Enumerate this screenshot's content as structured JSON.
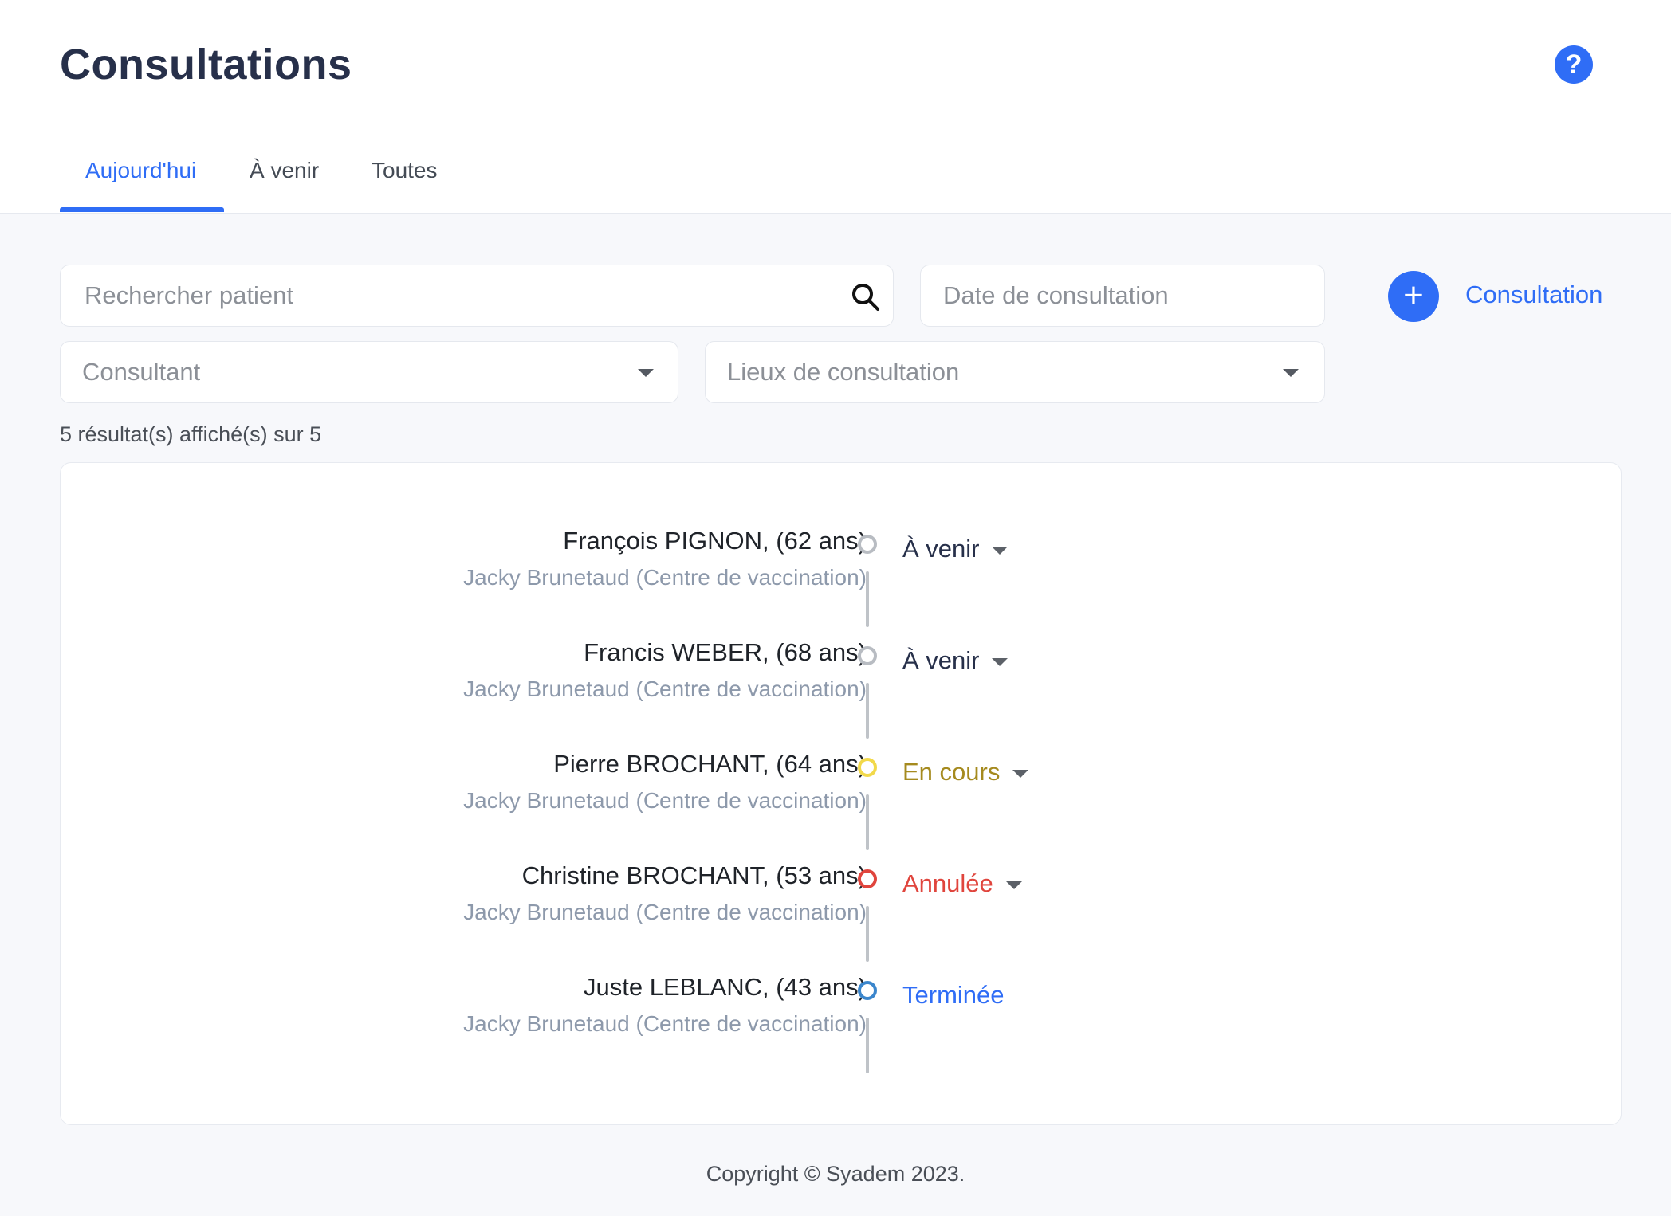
{
  "header": {
    "title": "Consultations",
    "help_icon": "question-mark-icon",
    "tabs": [
      {
        "label": "Aujourd'hui",
        "active": true
      },
      {
        "label": "À venir",
        "active": false
      },
      {
        "label": "Toutes",
        "active": false
      }
    ]
  },
  "filters": {
    "search_placeholder": "Rechercher patient",
    "date_placeholder": "Date de consultation",
    "consultant_placeholder": "Consultant",
    "location_placeholder": "Lieux de consultation",
    "add_button_icon": "plus-icon",
    "add_button_label": "Consultation"
  },
  "results": {
    "count_text": "5 résultat(s) affiché(s) sur 5"
  },
  "consultations": [
    {
      "patient": "François PIGNON, (62 ans)",
      "consultant": "Jacky Brunetaud (Centre de vaccination)",
      "status": "À venir",
      "status_color": "#27304a",
      "dot_color": "#b8bcc2",
      "has_dropdown": true
    },
    {
      "patient": "Francis WEBER, (68 ans)",
      "consultant": "Jacky Brunetaud (Centre de vaccination)",
      "status": "À venir",
      "status_color": "#27304a",
      "dot_color": "#b8bcc2",
      "has_dropdown": true
    },
    {
      "patient": "Pierre BROCHANT, (64 ans)",
      "consultant": "Jacky Brunetaud (Centre de vaccination)",
      "status": "En cours",
      "status_color": "#a58a1e",
      "dot_color": "#f2d94a",
      "has_dropdown": true
    },
    {
      "patient": "Christine BROCHANT, (53 ans)",
      "consultant": "Jacky Brunetaud (Centre de vaccination)",
      "status": "Annulée",
      "status_color": "#e0453d",
      "dot_color": "#e0453d",
      "has_dropdown": true
    },
    {
      "patient": "Juste LEBLANC, (43 ans)",
      "consultant": "Jacky Brunetaud (Centre de vaccination)",
      "status": "Terminée",
      "status_color": "#2f6df6",
      "dot_color": "#3b86cc",
      "has_dropdown": false
    }
  ],
  "footer": {
    "copyright": "Copyright © Syadem 2023."
  }
}
